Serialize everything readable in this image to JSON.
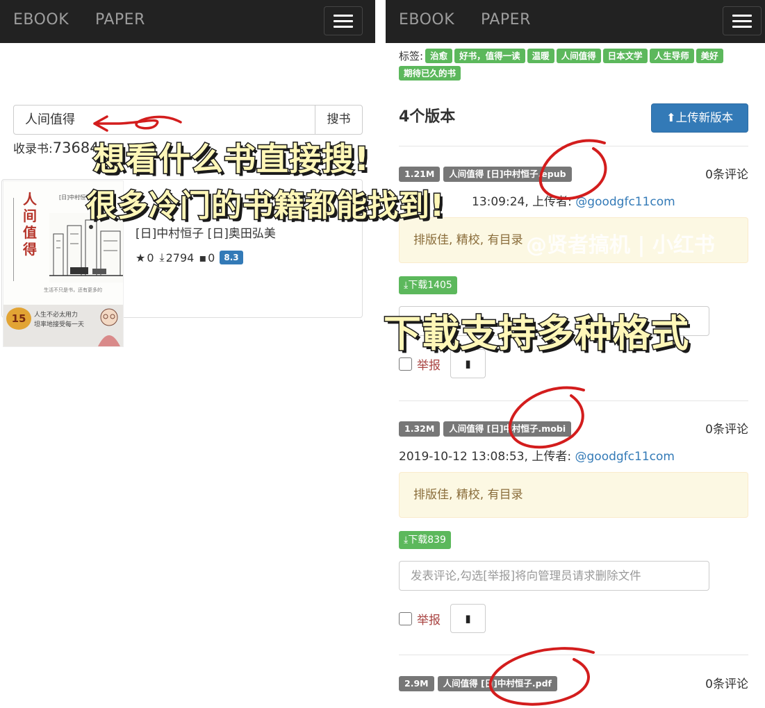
{
  "nav": {
    "ebook": "EBOOK",
    "paper": "PAPER"
  },
  "left": {
    "search_value": "人间值得",
    "search_button": "搜书",
    "count_label": "收录书:",
    "count_value": "73684",
    "book": {
      "cover": {
        "title": "人间值得",
        "author_text": "[日]中村恒子 奥田弘美",
        "caption": "生活不只是书，还有更多的",
        "badge": "15",
        "quote_line1": "人生不必太用力",
        "quote_line2": "坦率地接受每一天"
      },
      "authors": "[日]中村恒子 [日]奥田弘美",
      "stars": "0",
      "downloads": "2794",
      "comments": "0",
      "score": "8.3"
    }
  },
  "right": {
    "tags_label": "标签:",
    "tags": [
      "治愈",
      "好书，值得一读",
      "温暖",
      "人间值得",
      "日本文学",
      "人生导师",
      "美好",
      "期待已久的书"
    ],
    "versions_title": "4个版本",
    "upload_button": "上传新版本",
    "versions": [
      {
        "size": "1.21M",
        "filename": "人间值得 [日]中村恒子.epub",
        "comments": "0条评论",
        "datetime": "13:09:24, 上传者: ",
        "uploader": "@goodgfc11com",
        "note": "排版佳, 精校, 有目录",
        "download": "下载1405",
        "comment_placeholder": "",
        "report": "举报"
      },
      {
        "size": "1.32M",
        "filename": "人间值得 [日]中村恒子.mobi",
        "comments": "0条评论",
        "datetime": "2019-10-12 13:08:53, 上传者: ",
        "uploader": "@goodgfc11com",
        "note": "排版佳, 精校, 有目录",
        "download": "下载839",
        "comment_placeholder": "发表评论,勾选[举报]将向管理员请求删除文件",
        "report": "举报"
      },
      {
        "size": "2.9M",
        "filename": "人间值得 [日]中村恒子.pdf",
        "comments": "0条评论"
      }
    ]
  },
  "overlay": {
    "caption1": "想看什么书直接搜!",
    "caption2": "很多冷门的书籍都能找到!",
    "caption3": "下載支持多种格式",
    "watermark": "@贤者搞机 | 小红书"
  }
}
